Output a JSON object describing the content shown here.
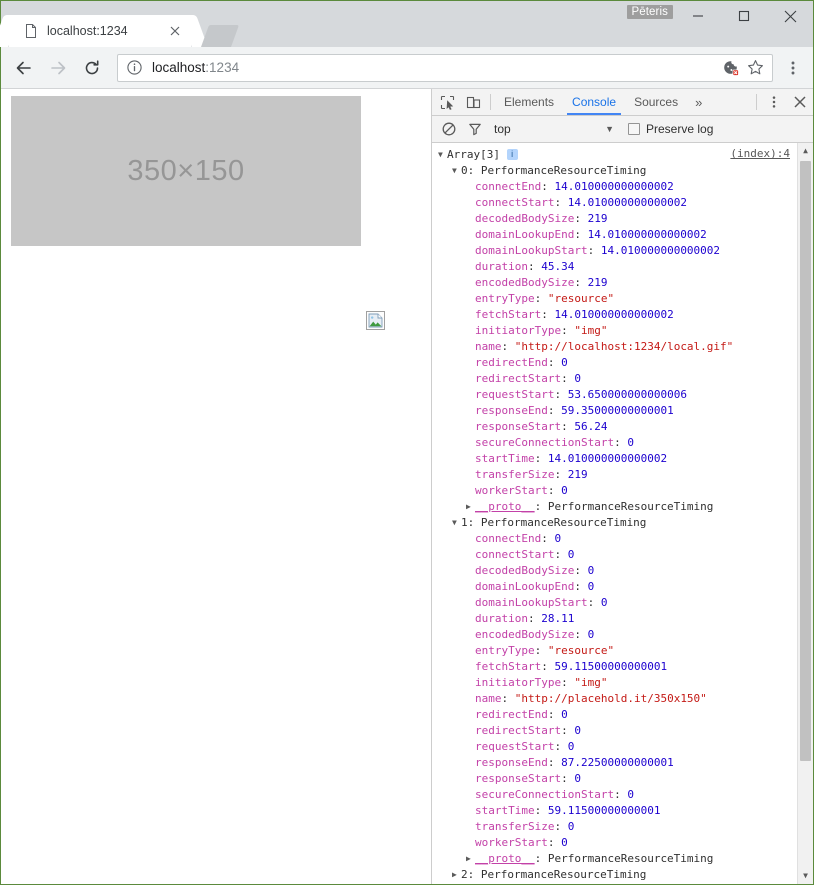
{
  "browser": {
    "tab": {
      "title": "localhost:1234",
      "favicon": "page-icon",
      "close": "×"
    },
    "profile_name": "Pēteris",
    "window_controls": {
      "minimize": "minimize-icon",
      "maximize": "maximize-icon",
      "close": "close-icon"
    },
    "toolbar": {
      "back": "back-arrow-icon",
      "forward": "forward-arrow-icon",
      "reload": "reload-icon",
      "url_main": "localhost",
      "url_port": ":1234",
      "info_icon": "page-info-icon",
      "cookie_icon": "cookie-blocked-icon",
      "bookmark_icon": "star-icon",
      "menu_icon": "three-dot-menu-icon"
    }
  },
  "page": {
    "placeholder_label": "350×150",
    "placeholder_bg": "#c6c6c6",
    "broken_image_icon": "broken-image-icon"
  },
  "devtools": {
    "icons": {
      "inspect": "inspect-element-icon",
      "device": "device-toolbar-icon",
      "more": "three-dot-menu-icon",
      "close": "close-icon"
    },
    "tabs": [
      {
        "label": "Elements",
        "active": false
      },
      {
        "label": "Console",
        "active": true
      },
      {
        "label": "Sources",
        "active": false
      }
    ],
    "overflow": "»",
    "filterbar": {
      "clear_icon": "clear-console-icon",
      "filter_icon": "filter-funnel-icon",
      "context": "top",
      "context_arrow": "▼",
      "preserve_log_label": "Preserve log",
      "preserve_log_checked": false
    },
    "console": {
      "source_link": "(index):4",
      "accent": "#4285f4",
      "colors": {
        "key": "#c341a8",
        "number": "#1c00cf",
        "string": "#c41a16",
        "plain": "#303030"
      },
      "lines": [
        {
          "indent": 0,
          "tri": "▼",
          "parts": [
            {
              "t": "plain",
              "v": "Array[3] "
            },
            {
              "t": "badge",
              "v": "i"
            }
          ]
        },
        {
          "indent": 1,
          "tri": "▼",
          "parts": [
            {
              "t": "plain",
              "v": "0: PerformanceResourceTiming"
            }
          ]
        },
        {
          "indent": 2,
          "tri": "",
          "parts": [
            {
              "t": "key",
              "v": "connectEnd"
            },
            {
              "t": "plain",
              "v": ": "
            },
            {
              "t": "num",
              "v": "14.010000000000002"
            }
          ]
        },
        {
          "indent": 2,
          "tri": "",
          "parts": [
            {
              "t": "key",
              "v": "connectStart"
            },
            {
              "t": "plain",
              "v": ": "
            },
            {
              "t": "num",
              "v": "14.010000000000002"
            }
          ]
        },
        {
          "indent": 2,
          "tri": "",
          "parts": [
            {
              "t": "key",
              "v": "decodedBodySize"
            },
            {
              "t": "plain",
              "v": ": "
            },
            {
              "t": "num",
              "v": "219"
            }
          ]
        },
        {
          "indent": 2,
          "tri": "",
          "parts": [
            {
              "t": "key",
              "v": "domainLookupEnd"
            },
            {
              "t": "plain",
              "v": ": "
            },
            {
              "t": "num",
              "v": "14.010000000000002"
            }
          ]
        },
        {
          "indent": 2,
          "tri": "",
          "parts": [
            {
              "t": "key",
              "v": "domainLookupStart"
            },
            {
              "t": "plain",
              "v": ": "
            },
            {
              "t": "num",
              "v": "14.010000000000002"
            }
          ]
        },
        {
          "indent": 2,
          "tri": "",
          "parts": [
            {
              "t": "key",
              "v": "duration"
            },
            {
              "t": "plain",
              "v": ": "
            },
            {
              "t": "num",
              "v": "45.34"
            }
          ]
        },
        {
          "indent": 2,
          "tri": "",
          "parts": [
            {
              "t": "key",
              "v": "encodedBodySize"
            },
            {
              "t": "plain",
              "v": ": "
            },
            {
              "t": "num",
              "v": "219"
            }
          ]
        },
        {
          "indent": 2,
          "tri": "",
          "parts": [
            {
              "t": "key",
              "v": "entryType"
            },
            {
              "t": "plain",
              "v": ": "
            },
            {
              "t": "str",
              "v": "\"resource\""
            }
          ]
        },
        {
          "indent": 2,
          "tri": "",
          "parts": [
            {
              "t": "key",
              "v": "fetchStart"
            },
            {
              "t": "plain",
              "v": ": "
            },
            {
              "t": "num",
              "v": "14.010000000000002"
            }
          ]
        },
        {
          "indent": 2,
          "tri": "",
          "parts": [
            {
              "t": "key",
              "v": "initiatorType"
            },
            {
              "t": "plain",
              "v": ": "
            },
            {
              "t": "str",
              "v": "\"img\""
            }
          ]
        },
        {
          "indent": 2,
          "tri": "",
          "parts": [
            {
              "t": "key",
              "v": "name"
            },
            {
              "t": "plain",
              "v": ": "
            },
            {
              "t": "str",
              "v": "\"http://localhost:1234/local.gif\""
            }
          ]
        },
        {
          "indent": 2,
          "tri": "",
          "parts": [
            {
              "t": "key",
              "v": "redirectEnd"
            },
            {
              "t": "plain",
              "v": ": "
            },
            {
              "t": "num",
              "v": "0"
            }
          ]
        },
        {
          "indent": 2,
          "tri": "",
          "parts": [
            {
              "t": "key",
              "v": "redirectStart"
            },
            {
              "t": "plain",
              "v": ": "
            },
            {
              "t": "num",
              "v": "0"
            }
          ]
        },
        {
          "indent": 2,
          "tri": "",
          "parts": [
            {
              "t": "key",
              "v": "requestStart"
            },
            {
              "t": "plain",
              "v": ": "
            },
            {
              "t": "num",
              "v": "53.650000000000006"
            }
          ]
        },
        {
          "indent": 2,
          "tri": "",
          "parts": [
            {
              "t": "key",
              "v": "responseEnd"
            },
            {
              "t": "plain",
              "v": ": "
            },
            {
              "t": "num",
              "v": "59.35000000000001"
            }
          ]
        },
        {
          "indent": 2,
          "tri": "",
          "parts": [
            {
              "t": "key",
              "v": "responseStart"
            },
            {
              "t": "plain",
              "v": ": "
            },
            {
              "t": "num",
              "v": "56.24"
            }
          ]
        },
        {
          "indent": 2,
          "tri": "",
          "parts": [
            {
              "t": "key",
              "v": "secureConnectionStart"
            },
            {
              "t": "plain",
              "v": ": "
            },
            {
              "t": "num",
              "v": "0"
            }
          ]
        },
        {
          "indent": 2,
          "tri": "",
          "parts": [
            {
              "t": "key",
              "v": "startTime"
            },
            {
              "t": "plain",
              "v": ": "
            },
            {
              "t": "num",
              "v": "14.010000000000002"
            }
          ]
        },
        {
          "indent": 2,
          "tri": "",
          "parts": [
            {
              "t": "key",
              "v": "transferSize"
            },
            {
              "t": "plain",
              "v": ": "
            },
            {
              "t": "num",
              "v": "219"
            }
          ]
        },
        {
          "indent": 2,
          "tri": "",
          "parts": [
            {
              "t": "key",
              "v": "workerStart"
            },
            {
              "t": "plain",
              "v": ": "
            },
            {
              "t": "num",
              "v": "0"
            }
          ]
        },
        {
          "indent": 2,
          "tri": "▶",
          "parts": [
            {
              "t": "proto",
              "v": "__proto__"
            },
            {
              "t": "plain",
              "v": ": PerformanceResourceTiming"
            }
          ]
        },
        {
          "indent": 1,
          "tri": "▼",
          "parts": [
            {
              "t": "plain",
              "v": "1: PerformanceResourceTiming"
            }
          ]
        },
        {
          "indent": 2,
          "tri": "",
          "parts": [
            {
              "t": "key",
              "v": "connectEnd"
            },
            {
              "t": "plain",
              "v": ": "
            },
            {
              "t": "num",
              "v": "0"
            }
          ]
        },
        {
          "indent": 2,
          "tri": "",
          "parts": [
            {
              "t": "key",
              "v": "connectStart"
            },
            {
              "t": "plain",
              "v": ": "
            },
            {
              "t": "num",
              "v": "0"
            }
          ]
        },
        {
          "indent": 2,
          "tri": "",
          "parts": [
            {
              "t": "key",
              "v": "decodedBodySize"
            },
            {
              "t": "plain",
              "v": ": "
            },
            {
              "t": "num",
              "v": "0"
            }
          ]
        },
        {
          "indent": 2,
          "tri": "",
          "parts": [
            {
              "t": "key",
              "v": "domainLookupEnd"
            },
            {
              "t": "plain",
              "v": ": "
            },
            {
              "t": "num",
              "v": "0"
            }
          ]
        },
        {
          "indent": 2,
          "tri": "",
          "parts": [
            {
              "t": "key",
              "v": "domainLookupStart"
            },
            {
              "t": "plain",
              "v": ": "
            },
            {
              "t": "num",
              "v": "0"
            }
          ]
        },
        {
          "indent": 2,
          "tri": "",
          "parts": [
            {
              "t": "key",
              "v": "duration"
            },
            {
              "t": "plain",
              "v": ": "
            },
            {
              "t": "num",
              "v": "28.11"
            }
          ]
        },
        {
          "indent": 2,
          "tri": "",
          "parts": [
            {
              "t": "key",
              "v": "encodedBodySize"
            },
            {
              "t": "plain",
              "v": ": "
            },
            {
              "t": "num",
              "v": "0"
            }
          ]
        },
        {
          "indent": 2,
          "tri": "",
          "parts": [
            {
              "t": "key",
              "v": "entryType"
            },
            {
              "t": "plain",
              "v": ": "
            },
            {
              "t": "str",
              "v": "\"resource\""
            }
          ]
        },
        {
          "indent": 2,
          "tri": "",
          "parts": [
            {
              "t": "key",
              "v": "fetchStart"
            },
            {
              "t": "plain",
              "v": ": "
            },
            {
              "t": "num",
              "v": "59.11500000000001"
            }
          ]
        },
        {
          "indent": 2,
          "tri": "",
          "parts": [
            {
              "t": "key",
              "v": "initiatorType"
            },
            {
              "t": "plain",
              "v": ": "
            },
            {
              "t": "str",
              "v": "\"img\""
            }
          ]
        },
        {
          "indent": 2,
          "tri": "",
          "parts": [
            {
              "t": "key",
              "v": "name"
            },
            {
              "t": "plain",
              "v": ": "
            },
            {
              "t": "str",
              "v": "\"http://placehold.it/350x150\""
            }
          ]
        },
        {
          "indent": 2,
          "tri": "",
          "parts": [
            {
              "t": "key",
              "v": "redirectEnd"
            },
            {
              "t": "plain",
              "v": ": "
            },
            {
              "t": "num",
              "v": "0"
            }
          ]
        },
        {
          "indent": 2,
          "tri": "",
          "parts": [
            {
              "t": "key",
              "v": "redirectStart"
            },
            {
              "t": "plain",
              "v": ": "
            },
            {
              "t": "num",
              "v": "0"
            }
          ]
        },
        {
          "indent": 2,
          "tri": "",
          "parts": [
            {
              "t": "key",
              "v": "requestStart"
            },
            {
              "t": "plain",
              "v": ": "
            },
            {
              "t": "num",
              "v": "0"
            }
          ]
        },
        {
          "indent": 2,
          "tri": "",
          "parts": [
            {
              "t": "key",
              "v": "responseEnd"
            },
            {
              "t": "plain",
              "v": ": "
            },
            {
              "t": "num",
              "v": "87.22500000000001"
            }
          ]
        },
        {
          "indent": 2,
          "tri": "",
          "parts": [
            {
              "t": "key",
              "v": "responseStart"
            },
            {
              "t": "plain",
              "v": ": "
            },
            {
              "t": "num",
              "v": "0"
            }
          ]
        },
        {
          "indent": 2,
          "tri": "",
          "parts": [
            {
              "t": "key",
              "v": "secureConnectionStart"
            },
            {
              "t": "plain",
              "v": ": "
            },
            {
              "t": "num",
              "v": "0"
            }
          ]
        },
        {
          "indent": 2,
          "tri": "",
          "parts": [
            {
              "t": "key",
              "v": "startTime"
            },
            {
              "t": "plain",
              "v": ": "
            },
            {
              "t": "num",
              "v": "59.11500000000001"
            }
          ]
        },
        {
          "indent": 2,
          "tri": "",
          "parts": [
            {
              "t": "key",
              "v": "transferSize"
            },
            {
              "t": "plain",
              "v": ": "
            },
            {
              "t": "num",
              "v": "0"
            }
          ]
        },
        {
          "indent": 2,
          "tri": "",
          "parts": [
            {
              "t": "key",
              "v": "workerStart"
            },
            {
              "t": "plain",
              "v": ": "
            },
            {
              "t": "num",
              "v": "0"
            }
          ]
        },
        {
          "indent": 2,
          "tri": "▶",
          "parts": [
            {
              "t": "proto",
              "v": "__proto__"
            },
            {
              "t": "plain",
              "v": ": PerformanceResourceTiming"
            }
          ]
        },
        {
          "indent": 1,
          "tri": "▶",
          "parts": [
            {
              "t": "plain",
              "v": "2: PerformanceResourceTiming"
            }
          ]
        }
      ]
    }
  }
}
